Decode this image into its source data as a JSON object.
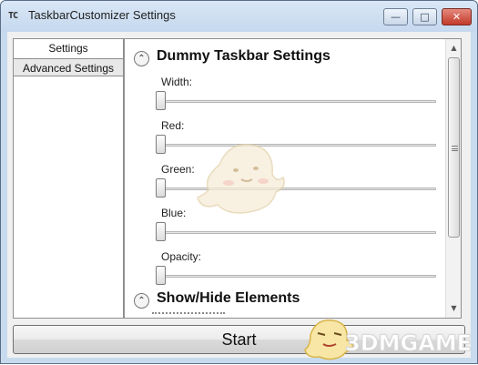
{
  "window": {
    "title": "TaskbarCustomizer Settings",
    "app_icon_text": "TC",
    "buttons": {
      "minimize": "—",
      "maximize": "□",
      "close": "✕"
    }
  },
  "tabs": [
    {
      "label": "Settings",
      "selected": true
    },
    {
      "label": "Advanced Settings",
      "selected": false
    }
  ],
  "sections": {
    "dummy_taskbar": {
      "title": "Dummy Taskbar Settings",
      "collapse_glyph": "⌃",
      "fields": [
        {
          "label": "Width:",
          "value": 0
        },
        {
          "label": "Red:",
          "value": 0
        },
        {
          "label": "Green:",
          "value": 0
        },
        {
          "label": "Blue:",
          "value": 0
        },
        {
          "label": "Opacity:",
          "value": 0
        }
      ]
    },
    "show_hide": {
      "title": "Show/Hide Elements",
      "collapse_glyph": "⌃"
    }
  },
  "scrollbar": {
    "up": "▲",
    "down": "▼"
  },
  "start_button": {
    "label": "Start"
  },
  "watermark": {
    "text": "3DMGAME"
  },
  "colors": {
    "titlebar": "#c8dbee",
    "client_background": "#f0f0f0",
    "close_button": "#c23a2a"
  }
}
